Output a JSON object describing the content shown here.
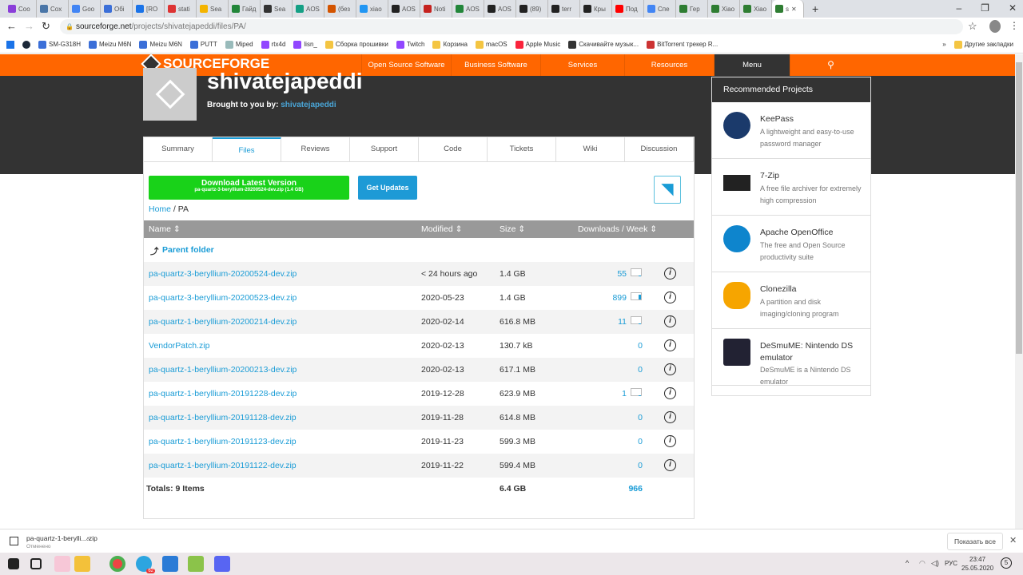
{
  "browser": {
    "tabs": [
      "Coo",
      "Cox",
      "Goo",
      "Обі",
      "[RO",
      "stati",
      "Sea",
      "Гайд",
      "Sea",
      "AOS",
      "(без",
      "xiao",
      "AOS",
      "Noti",
      "AOS",
      "AOS",
      "(89)",
      "terr",
      "Кры",
      "Под",
      "Спе",
      "Гер",
      "Xiao",
      "Xiao",
      "s"
    ],
    "tab_colors": [
      "#8b3fd9",
      "#4a76a8",
      "#4285f4",
      "#3b6fd8",
      "#1a73e8",
      "#d33",
      "#f4b400",
      "#22863a",
      "#333",
      "#15a085",
      "#d35400",
      "#2196f3",
      "#222",
      "#c5221f",
      "#22863a",
      "#222",
      "#222",
      "#222",
      "#222",
      "#ff0000",
      "#4285f4",
      "#2e7d32",
      "#2e7d32",
      "#2e7d32",
      "#2e7d32"
    ],
    "url_host": "sourceforge.net",
    "url_path": "/projects/shivatejapeddi/files/PA/",
    "bookmarks": [
      "SM-G318H",
      "Meizu M6N",
      "Meizu M6N",
      "PUTT",
      "Miped",
      "rtx4d",
      "lisn_",
      "Сборка прошивки",
      "Twitch",
      "Корзина",
      "macOS",
      "Apple Music",
      "Скачивайте музык...",
      "BitTorrent трекер R..."
    ],
    "more_bookmarks": "»",
    "other_bookmarks": "Другие закладки"
  },
  "sf": {
    "brand": "SOURCEFORGE",
    "nav": [
      "Open Source Software",
      "Business Software",
      "Services",
      "Resources",
      "Menu"
    ],
    "search_icon": "search-icon",
    "accent": "#ff6600"
  },
  "project": {
    "name": "shivatejapeddi",
    "brought_label": "Brought to you by:",
    "brought_by": "shivatejapeddi",
    "tabs": [
      "Summary",
      "Files",
      "Reviews",
      "Support",
      "Code",
      "Tickets",
      "Wiki",
      "Discussion"
    ],
    "active_tab": "Files"
  },
  "files": {
    "download_title": "Download Latest Version",
    "download_file": "pa-quartz-3-beryllium-20200524-dev.zip (1.4 GB)",
    "get_updates": "Get Updates",
    "crumb_home": "Home",
    "crumb_sep": " / ",
    "crumb_current": "PA",
    "headers": {
      "name": "Name ⇕",
      "modified": "Modified ⇕",
      "size": "Size ⇕",
      "downloads": "Downloads / Week ⇕"
    },
    "parent": "Parent folder",
    "rows": [
      {
        "name": "pa-quartz-3-beryllium-20200524-dev.zip",
        "modified": "< 24 hours ago",
        "size": "1.4 GB",
        "downloads": "55",
        "bar": 0.05
      },
      {
        "name": "pa-quartz-3-beryllium-20200523-dev.zip",
        "modified": "2020-05-23",
        "size": "1.4 GB",
        "downloads": "899",
        "bar": 0.8
      },
      {
        "name": "pa-quartz-1-beryllium-20200214-dev.zip",
        "modified": "2020-02-14",
        "size": "616.8 MB",
        "downloads": "11",
        "bar": 0.02
      },
      {
        "name": "VendorPatch.zip",
        "modified": "2020-02-13",
        "size": "130.7 kB",
        "downloads": "0"
      },
      {
        "name": "pa-quartz-1-beryllium-20200213-dev.zip",
        "modified": "2020-02-13",
        "size": "617.1 MB",
        "downloads": "0"
      },
      {
        "name": "pa-quartz-1-beryllium-20191228-dev.zip",
        "modified": "2019-12-28",
        "size": "623.9 MB",
        "downloads": "1",
        "bar": 0.01
      },
      {
        "name": "pa-quartz-1-beryllium-20191128-dev.zip",
        "modified": "2019-11-28",
        "size": "614.8 MB",
        "downloads": "0"
      },
      {
        "name": "pa-quartz-1-beryllium-20191123-dev.zip",
        "modified": "2019-11-23",
        "size": "599.3 MB",
        "downloads": "0"
      },
      {
        "name": "pa-quartz-1-beryllium-20191122-dev.zip",
        "modified": "2019-11-22",
        "size": "599.4 MB",
        "downloads": "0"
      }
    ],
    "totals_label": "Totals: 9 Items",
    "totals_size": "6.4 GB",
    "totals_downloads": "966"
  },
  "recommended": {
    "title": "Recommended Projects",
    "items": [
      {
        "name": "KeePass",
        "desc": "A lightweight and easy-to-use password manager"
      },
      {
        "name": "7-Zip",
        "desc": "A free file archiver for extremely high compression"
      },
      {
        "name": "Apache OpenOffice",
        "desc": "The free and Open Source productivity suite"
      },
      {
        "name": "Clonezilla",
        "desc": "A partition and disk imaging/cloning program"
      },
      {
        "name": "DeSmuME: Nintendo DS emulator",
        "desc": "DeSmuME is a Nintendo DS emulator"
      }
    ]
  },
  "download_shelf": {
    "file": "pa-quartz-1-berylli....zip",
    "status": "Отменено",
    "show_all": "Показать все"
  },
  "taskbar": {
    "lang": "РУС",
    "time": "23:47",
    "date": "25.05.2020",
    "notifications": "5",
    "telegram_badge": "62"
  }
}
